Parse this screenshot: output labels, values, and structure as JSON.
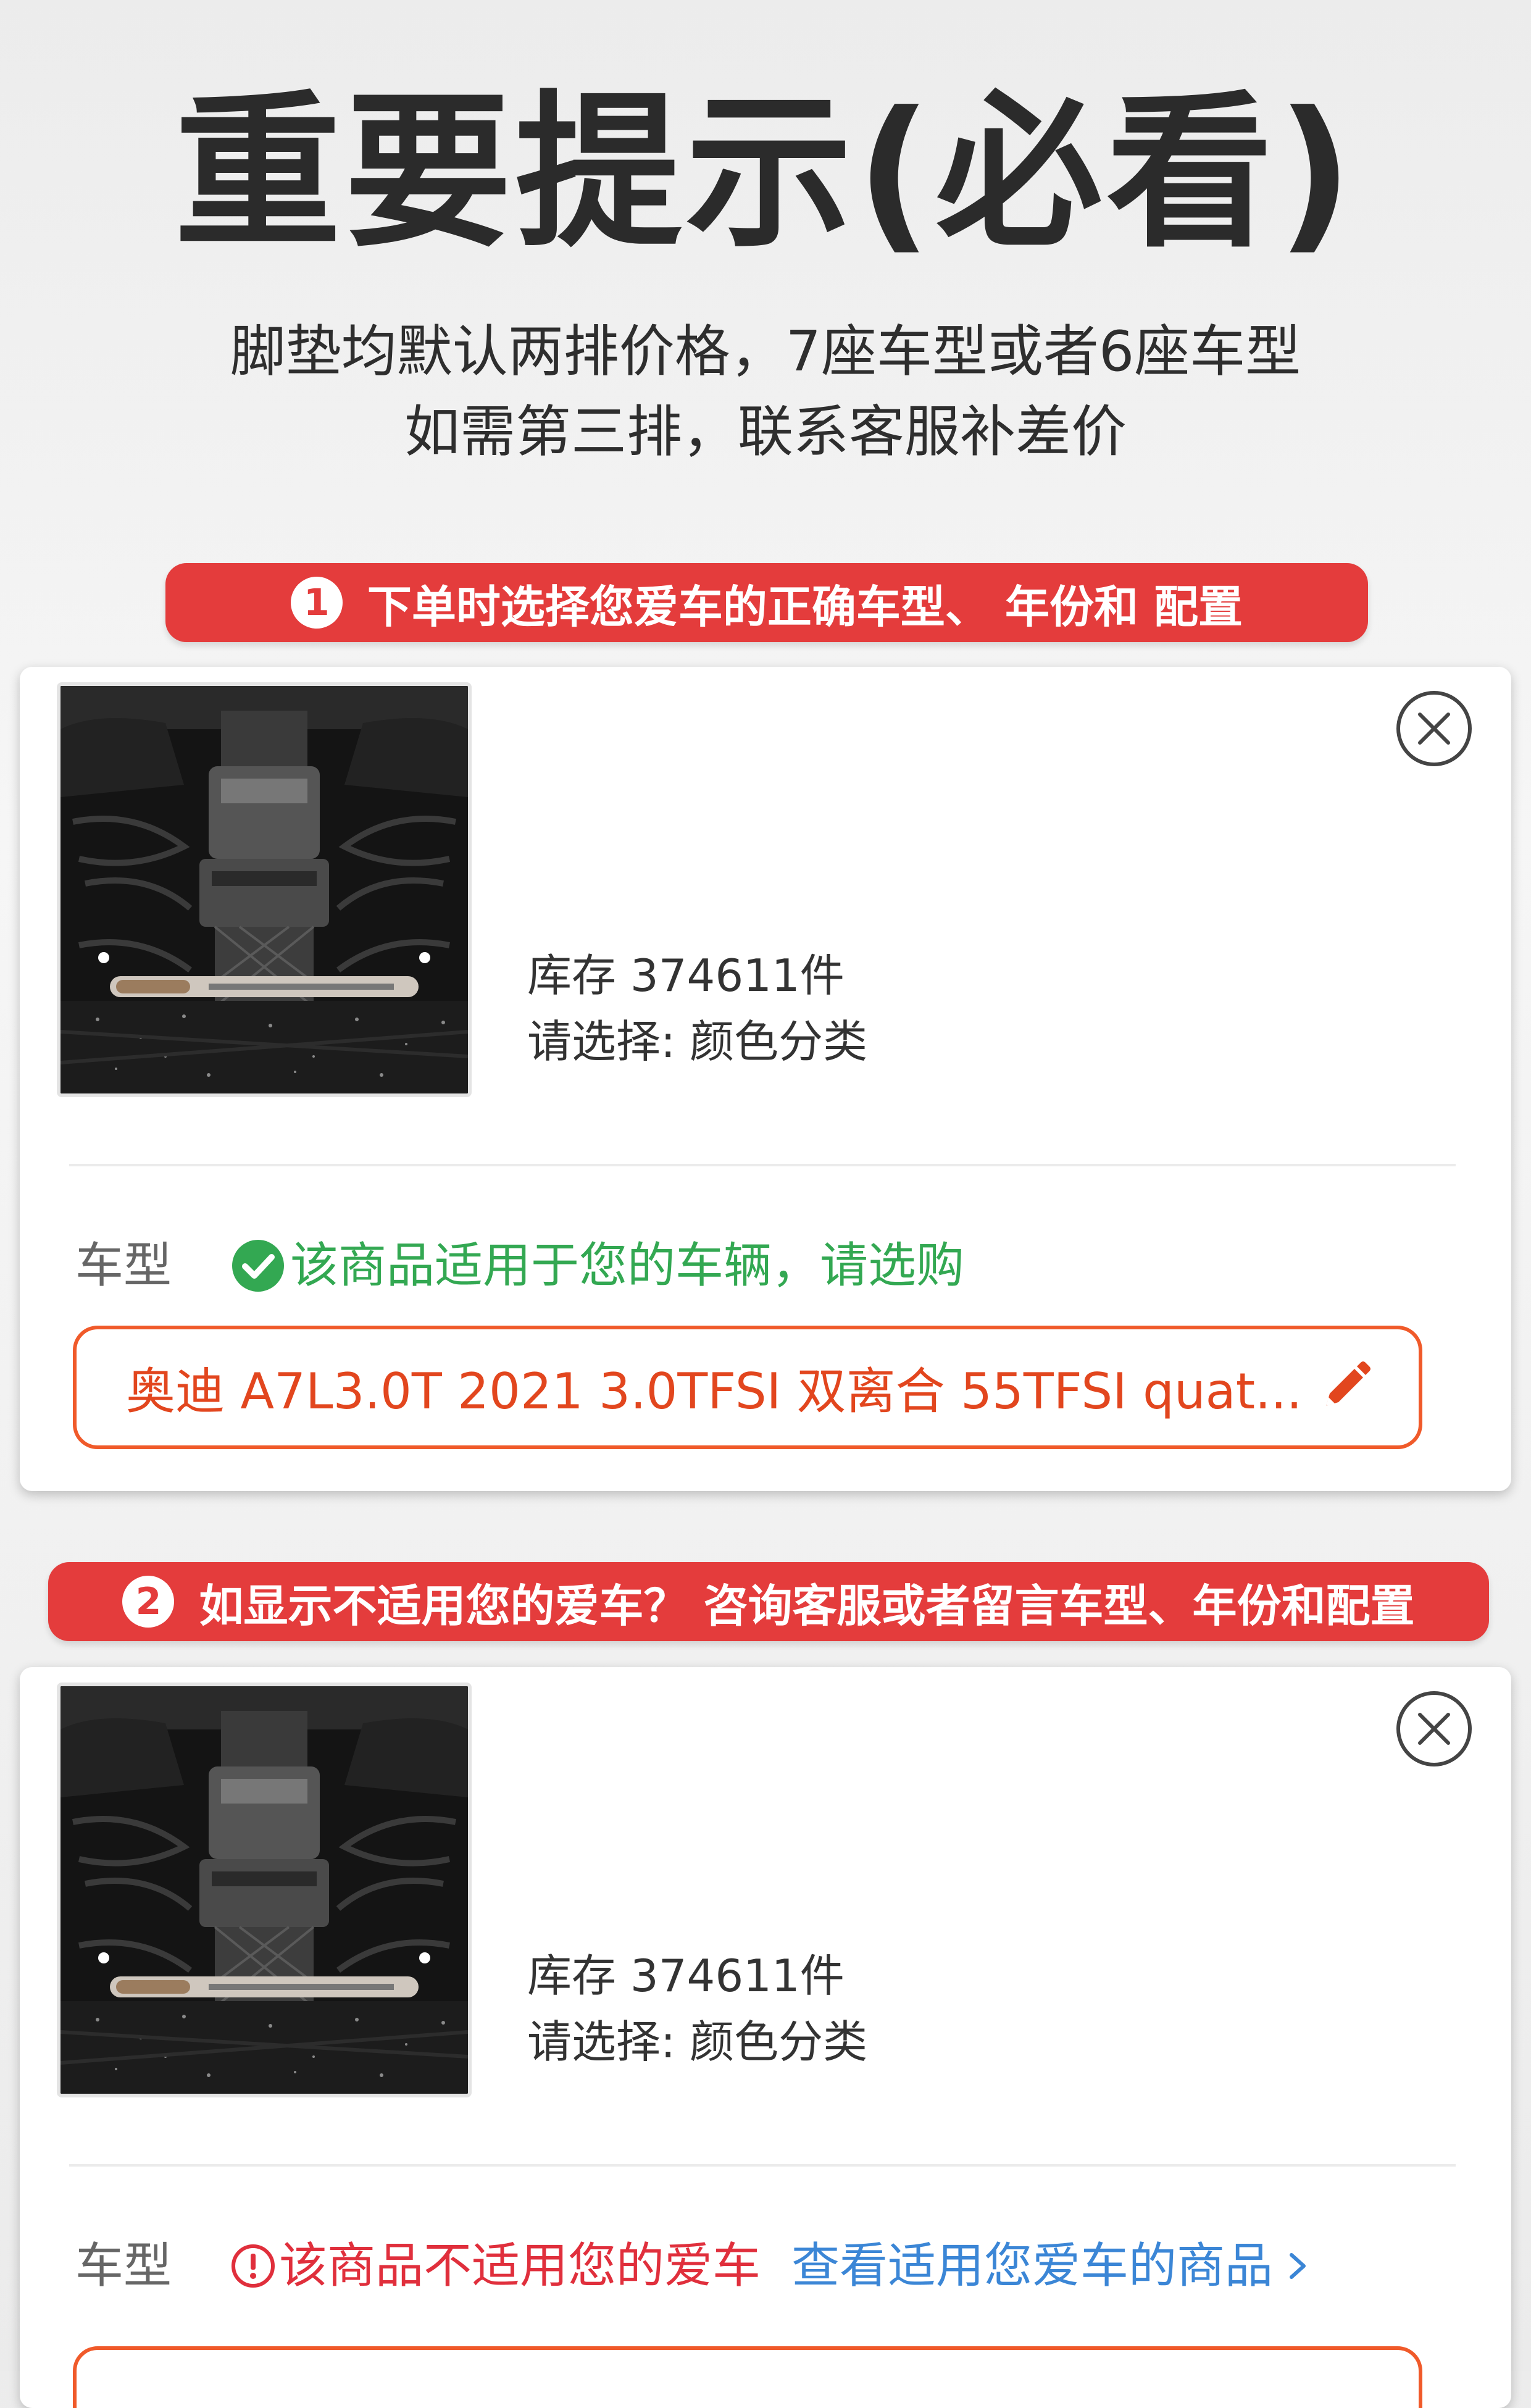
{
  "title": "重要提示(必看)",
  "subtitle": {
    "line1": "脚垫均默认两排价格，7座车型或者6座车型",
    "line2": "如需第三排，联系客服补差价"
  },
  "steps": [
    {
      "num": "1",
      "text": "下单时选择您爱车的正确车型、 年份和 配置"
    },
    {
      "num": "2",
      "text": "如显示不适用您的爱车？ 咨询客服或者留言车型、年份和配置"
    }
  ],
  "cards": [
    {
      "stock": "库存 374611件",
      "select": "请选择: 颜色分类",
      "type_label": "车型",
      "fit_text": "该商品适用于您的车辆，请选购",
      "model": "奥迪 A7L3.0T 2021 3.0TFSI 双离合 55TFSI quat..."
    },
    {
      "stock": "库存 374611件",
      "select": "请选择: 颜色分类",
      "type_label": "车型",
      "fit_text": "该商品不适用您的爱车",
      "alt_link": "查看适用您爱车的商品"
    }
  ],
  "colors": {
    "banner": "#e43c3c",
    "ok": "#33a852",
    "bad": "#e02f3c",
    "link": "#3b86d6",
    "model_border": "#f05a2a"
  },
  "icons": [
    "close-icon",
    "check-circle-icon",
    "warning-circle-icon",
    "chevron-right-icon",
    "pencil-icon"
  ]
}
